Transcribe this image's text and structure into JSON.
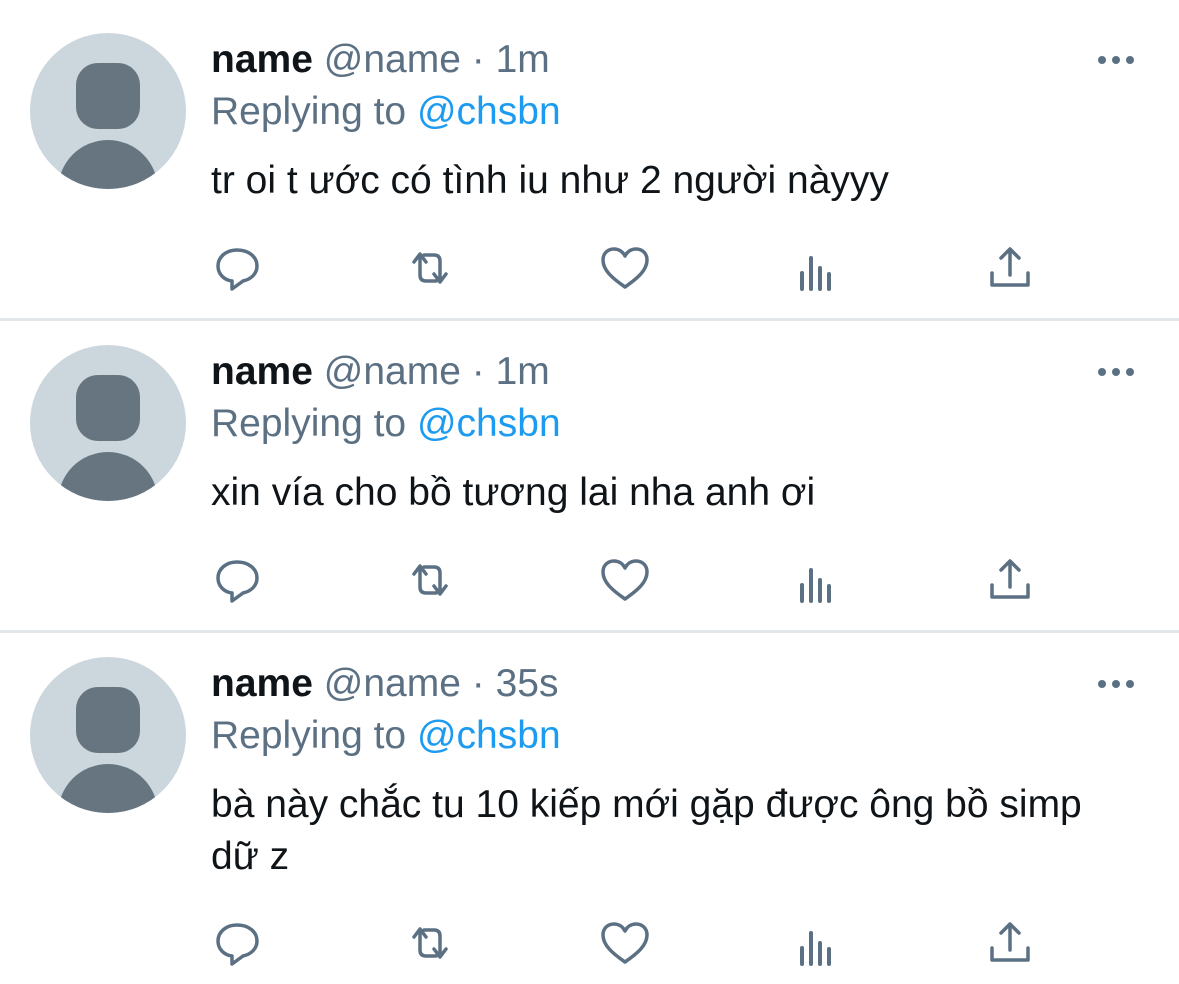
{
  "tweets": [
    {
      "display_name": "name",
      "handle": "@name",
      "separator": "·",
      "time": "1m",
      "replying_prefix": "Replying to",
      "replying_to": "@chsbn",
      "text": "tr oi t ước có tình iu như 2 người nàyyy"
    },
    {
      "display_name": "name",
      "handle": "@name",
      "separator": "·",
      "time": "1m",
      "replying_prefix": "Replying to",
      "replying_to": "@chsbn",
      "text": "xin vía cho bồ tương lai nha anh ơi"
    },
    {
      "display_name": "name",
      "handle": "@name",
      "separator": "·",
      "time": "35s",
      "replying_prefix": "Replying to",
      "replying_to": "@chsbn",
      "text": "bà này chắc tu 10 kiếp mới gặp được ông bồ simp dữ z"
    }
  ],
  "icons": {
    "avatar": "default-profile-avatar",
    "more": "more-options-icon",
    "reply": "reply-icon",
    "retweet": "retweet-icon",
    "like": "like-heart-icon",
    "analytics": "analytics-icon",
    "share": "share-icon"
  },
  "colors": {
    "text_primary": "#0f1419",
    "text_secondary": "#5b7083",
    "mention": "#1d9bf0",
    "icon": "#5b7083",
    "avatar_bg": "#ccd6dd",
    "avatar_fg": "#66757f",
    "divider": "#e3e6e8"
  }
}
